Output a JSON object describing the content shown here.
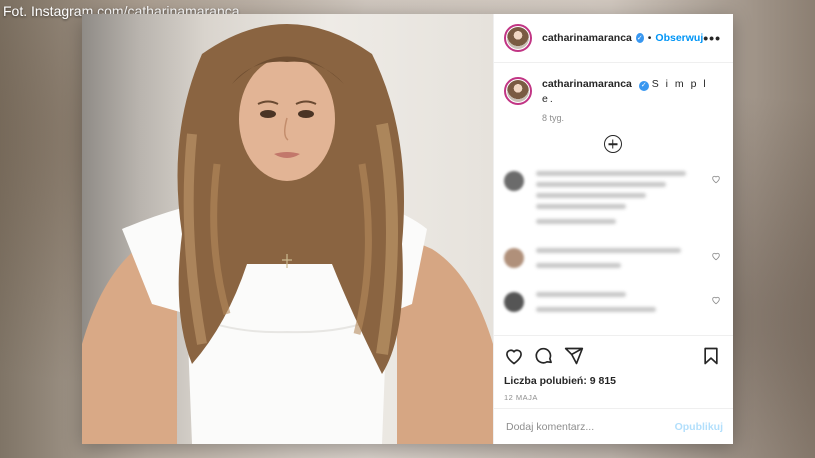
{
  "photo_caption": "Fot. Instagram.com/catharinamaranca",
  "header": {
    "username": "catharinamaranca",
    "separator": "•",
    "follow_label": "Obserwuj",
    "more_label": "•••"
  },
  "caption": {
    "username": "catharinamaranca",
    "text": "S i m p l e.",
    "time": "8 tyg."
  },
  "verified_glyph": "✓",
  "actions": {
    "likes": "Liczba polubień: 9 815",
    "date": "12 MAJA"
  },
  "comment_box": {
    "placeholder": "Dodaj komentarz...",
    "publish_label": "Opublikuj"
  },
  "colors": {
    "accent": "#0095f6",
    "verified": "#3897f0",
    "publish_disabled": "#b2dffc"
  }
}
